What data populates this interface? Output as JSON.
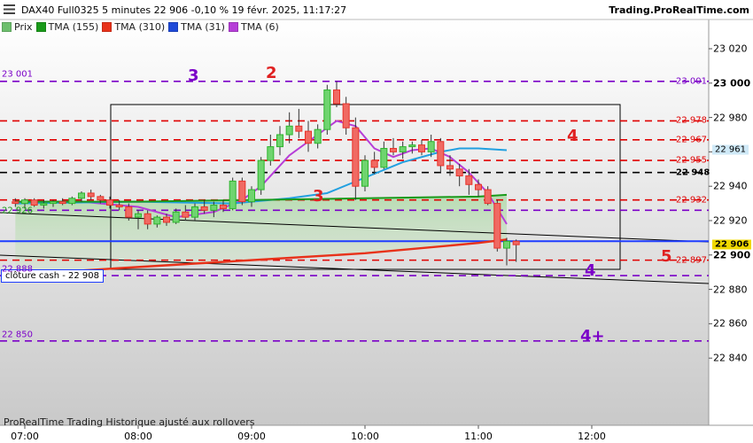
{
  "header": {
    "title": "DAX40 Full0325 5 minutes 22 906 -0,10 % 19 févr. 2025, 11:17:27",
    "brand": "Trading.ProRealTime.com"
  },
  "legend": [
    {
      "label": "Prix",
      "color": "#6dbf6d"
    },
    {
      "label": "TMA (155)",
      "color": "#1a9a1a"
    },
    {
      "label": "TMA (310)",
      "color": "#e8321a"
    },
    {
      "label": "TMA (31)",
      "color": "#22a0e0"
    },
    {
      "label": "TMA (6)",
      "color": "#b63ed8"
    }
  ],
  "footer": "ProRealTime Trading  Historique ajusté aux rollovers",
  "cash_label": "clôture cash -  22 908",
  "chart_data": {
    "type": "candlestick",
    "ylim": [
      22840,
      23030
    ],
    "y_ticks": [
      {
        "v": 23020,
        "label": "23 020"
      },
      {
        "v": 23000,
        "label": "23 000",
        "bold": true
      },
      {
        "v": 22980,
        "label": "22 980"
      },
      {
        "v": 22960,
        "label": "22 960"
      },
      {
        "v": 22940,
        "label": "22 940"
      },
      {
        "v": 22920,
        "label": "22 920"
      },
      {
        "v": 22900,
        "label": "22 900",
        "bold": true
      },
      {
        "v": 22880,
        "label": "22 880"
      },
      {
        "v": 22860,
        "label": "22 860"
      },
      {
        "v": 22840,
        "label": "22 840"
      }
    ],
    "x_ticks": [
      "07:00",
      "08:00",
      "09:00",
      "10:00",
      "11:00",
      "12:00"
    ],
    "levels": [
      {
        "value": 23001,
        "color": "#7b00c8",
        "label_left": "23 001",
        "label_right": "23 001"
      },
      {
        "value": 22978,
        "color": "#e00000",
        "label_right": "22 978"
      },
      {
        "value": 22967,
        "color": "#e00000",
        "label_right": "22 967"
      },
      {
        "value": 22955,
        "color": "#e00000",
        "label_right": "22 955"
      },
      {
        "value": 22948,
        "color": "#000000",
        "label_right": "22 948"
      },
      {
        "value": 22932,
        "color": "#e00000",
        "label_right": "22 932"
      },
      {
        "value": 22926,
        "color": "#7b00c8"
      },
      {
        "value": 22897,
        "color": "#e00000",
        "label_right": "22 897"
      },
      {
        "value": 22888,
        "color": "#7b00c8",
        "label_left": "22 888"
      },
      {
        "value": 22850,
        "color": "#7b00c8",
        "label_left": "22 850"
      }
    ],
    "left_price_label": "22 926",
    "cash_close": 22908,
    "current_price": {
      "value": 22906,
      "label": "22 906"
    },
    "tma31_badge": {
      "value": 22961,
      "label": "22 961"
    },
    "annotations": [
      {
        "text": "3",
        "color": "#7b00c8"
      },
      {
        "text": "2",
        "color": "#e02020"
      },
      {
        "text": "3",
        "color": "#e02020"
      },
      {
        "text": "4",
        "color": "#e02020"
      },
      {
        "text": "5",
        "color": "#e02020"
      },
      {
        "text": "4",
        "color": "#7b00c8"
      },
      {
        "text": "4+",
        "color": "#7b00c8"
      }
    ],
    "candles": [
      {
        "t": "06:55",
        "o": 22931,
        "h": 22933,
        "l": 22928,
        "c": 22930
      },
      {
        "t": "07:00",
        "o": 22930,
        "h": 22933,
        "l": 22927,
        "c": 22932
      },
      {
        "t": "07:05",
        "o": 22932,
        "h": 22933,
        "l": 22928,
        "c": 22929
      },
      {
        "t": "07:10",
        "o": 22929,
        "h": 22932,
        "l": 22927,
        "c": 22930
      },
      {
        "t": "07:15",
        "o": 22930,
        "h": 22932,
        "l": 22928,
        "c": 22931
      },
      {
        "t": "07:20",
        "o": 22931,
        "h": 22933,
        "l": 22929,
        "c": 22930
      },
      {
        "t": "07:25",
        "o": 22930,
        "h": 22934,
        "l": 22929,
        "c": 22933
      },
      {
        "t": "07:30",
        "o": 22933,
        "h": 22937,
        "l": 22931,
        "c": 22936
      },
      {
        "t": "07:35",
        "o": 22936,
        "h": 22938,
        "l": 22932,
        "c": 22934
      },
      {
        "t": "07:40",
        "o": 22934,
        "h": 22935,
        "l": 22930,
        "c": 22932
      },
      {
        "t": "07:45",
        "o": 22932,
        "h": 22934,
        "l": 22927,
        "c": 22929
      },
      {
        "t": "07:50",
        "o": 22929,
        "h": 22932,
        "l": 22926,
        "c": 22928
      },
      {
        "t": "07:55",
        "o": 22928,
        "h": 22930,
        "l": 22920,
        "c": 22922
      },
      {
        "t": "08:00",
        "o": 22922,
        "h": 22926,
        "l": 22915,
        "c": 22924
      },
      {
        "t": "08:05",
        "o": 22924,
        "h": 22926,
        "l": 22915,
        "c": 22918
      },
      {
        "t": "08:10",
        "o": 22918,
        "h": 22923,
        "l": 22916,
        "c": 22922
      },
      {
        "t": "08:15",
        "o": 22922,
        "h": 22924,
        "l": 22917,
        "c": 22919
      },
      {
        "t": "08:20",
        "o": 22919,
        "h": 22927,
        "l": 22918,
        "c": 22925
      },
      {
        "t": "08:25",
        "o": 22925,
        "h": 22929,
        "l": 22920,
        "c": 22922
      },
      {
        "t": "08:30",
        "o": 22922,
        "h": 22930,
        "l": 22920,
        "c": 22928
      },
      {
        "t": "08:35",
        "o": 22928,
        "h": 22932,
        "l": 22924,
        "c": 22926
      },
      {
        "t": "08:40",
        "o": 22926,
        "h": 22931,
        "l": 22922,
        "c": 22929
      },
      {
        "t": "08:45",
        "o": 22929,
        "h": 22932,
        "l": 22925,
        "c": 22927
      },
      {
        "t": "08:50",
        "o": 22927,
        "h": 22945,
        "l": 22926,
        "c": 22943
      },
      {
        "t": "08:55",
        "o": 22943,
        "h": 22945,
        "l": 22929,
        "c": 22931
      },
      {
        "t": "09:00",
        "o": 22931,
        "h": 22940,
        "l": 22928,
        "c": 22938
      },
      {
        "t": "09:05",
        "o": 22938,
        "h": 22957,
        "l": 22935,
        "c": 22955
      },
      {
        "t": "09:10",
        "o": 22955,
        "h": 22970,
        "l": 22952,
        "c": 22963
      },
      {
        "t": "09:15",
        "o": 22963,
        "h": 22975,
        "l": 22958,
        "c": 22970
      },
      {
        "t": "09:20",
        "o": 22970,
        "h": 22983,
        "l": 22965,
        "c": 22975
      },
      {
        "t": "09:25",
        "o": 22975,
        "h": 22985,
        "l": 22968,
        "c": 22972
      },
      {
        "t": "09:30",
        "o": 22972,
        "h": 22978,
        "l": 22960,
        "c": 22965
      },
      {
        "t": "09:35",
        "o": 22965,
        "h": 22976,
        "l": 22962,
        "c": 22973
      },
      {
        "t": "09:40",
        "o": 22973,
        "h": 22999,
        "l": 22970,
        "c": 22996
      },
      {
        "t": "09:45",
        "o": 22996,
        "h": 23001,
        "l": 22986,
        "c": 22988
      },
      {
        "t": "09:50",
        "o": 22988,
        "h": 22992,
        "l": 22970,
        "c": 22974
      },
      {
        "t": "09:55",
        "o": 22974,
        "h": 22980,
        "l": 22932,
        "c": 22940
      },
      {
        "t": "10:00",
        "o": 22940,
        "h": 22958,
        "l": 22937,
        "c": 22955
      },
      {
        "t": "10:05",
        "o": 22955,
        "h": 22960,
        "l": 22947,
        "c": 22951
      },
      {
        "t": "10:10",
        "o": 22951,
        "h": 22966,
        "l": 22950,
        "c": 22962
      },
      {
        "t": "10:15",
        "o": 22962,
        "h": 22968,
        "l": 22958,
        "c": 22960
      },
      {
        "t": "10:20",
        "o": 22960,
        "h": 22966,
        "l": 22956,
        "c": 22963
      },
      {
        "t": "10:25",
        "o": 22963,
        "h": 22966,
        "l": 22959,
        "c": 22964
      },
      {
        "t": "10:30",
        "o": 22964,
        "h": 22967,
        "l": 22958,
        "c": 22960
      },
      {
        "t": "10:35",
        "o": 22960,
        "h": 22970,
        "l": 22957,
        "c": 22966
      },
      {
        "t": "10:40",
        "o": 22966,
        "h": 22968,
        "l": 22948,
        "c": 22952
      },
      {
        "t": "10:45",
        "o": 22952,
        "h": 22958,
        "l": 22946,
        "c": 22950
      },
      {
        "t": "10:50",
        "o": 22950,
        "h": 22953,
        "l": 22940,
        "c": 22946
      },
      {
        "t": "10:55",
        "o": 22946,
        "h": 22950,
        "l": 22935,
        "c": 22941
      },
      {
        "t": "11:00",
        "o": 22941,
        "h": 22944,
        "l": 22934,
        "c": 22938
      },
      {
        "t": "11:05",
        "o": 22938,
        "h": 22940,
        "l": 22929,
        "c": 22930
      },
      {
        "t": "11:10",
        "o": 22930,
        "h": 22932,
        "l": 22902,
        "c": 22904
      },
      {
        "t": "11:15",
        "o": 22904,
        "h": 22910,
        "l": 22894,
        "c": 22908
      },
      {
        "t": "11:20",
        "o": 22908,
        "h": 22909,
        "l": 22896,
        "c": 22906
      }
    ],
    "tma": [
      {
        "name": "TMA (6)",
        "color": "#b63ed8",
        "points": [
          [
            "06:55",
            22931
          ],
          [
            "07:30",
            22931
          ],
          [
            "08:00",
            22928
          ],
          [
            "08:20",
            22922
          ],
          [
            "08:40",
            22925
          ],
          [
            "08:55",
            22932
          ],
          [
            "09:05",
            22940
          ],
          [
            "09:20",
            22958
          ],
          [
            "09:35",
            22970
          ],
          [
            "09:45",
            22978
          ],
          [
            "09:55",
            22975
          ],
          [
            "10:05",
            22962
          ],
          [
            "10:15",
            22957
          ],
          [
            "10:25",
            22961
          ],
          [
            "10:35",
            22962
          ],
          [
            "10:45",
            22957
          ],
          [
            "10:55",
            22948
          ],
          [
            "11:05",
            22936
          ],
          [
            "11:15",
            22918
          ]
        ]
      },
      {
        "name": "TMA (31)",
        "color": "#22a0e0",
        "points": [
          [
            "06:55",
            22930
          ],
          [
            "08:00",
            22931
          ],
          [
            "08:50",
            22930
          ],
          [
            "09:20",
            22933
          ],
          [
            "09:40",
            22936
          ],
          [
            "10:00",
            22945
          ],
          [
            "10:20",
            22954
          ],
          [
            "10:40",
            22960
          ],
          [
            "10:50",
            22962
          ],
          [
            "11:00",
            22962
          ],
          [
            "11:15",
            22961
          ]
        ]
      },
      {
        "name": "TMA (155)",
        "color": "#1a9a1a",
        "points": [
          [
            "06:55",
            22931
          ],
          [
            "08:00",
            22931
          ],
          [
            "09:00",
            22932
          ],
          [
            "10:00",
            22933
          ],
          [
            "11:00",
            22934
          ],
          [
            "11:15",
            22935
          ]
        ]
      },
      {
        "name": "TMA (310)",
        "color": "#e8321a",
        "points": [
          [
            "06:55",
            22888
          ],
          [
            "07:30",
            22891
          ],
          [
            "08:00",
            22893
          ],
          [
            "09:00",
            22897
          ],
          [
            "10:00",
            22901
          ],
          [
            "11:00",
            22907
          ],
          [
            "11:15",
            22909
          ]
        ]
      }
    ]
  }
}
